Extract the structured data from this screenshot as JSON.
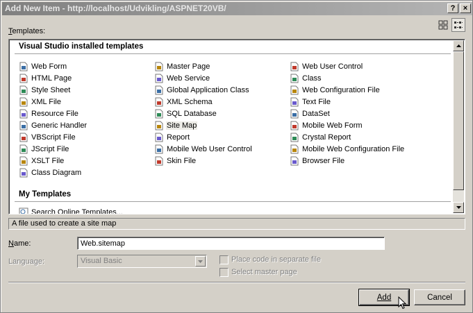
{
  "window": {
    "title": "Add New Item - http://localhost/Udvikling/ASPNET20VB/",
    "help_button": "?",
    "close_button": "×"
  },
  "templates_label": "Templates:",
  "sections": {
    "installed": "Visual Studio installed templates",
    "my": "My Templates"
  },
  "columns": [
    [
      {
        "label": "Web Form",
        "icon": "web-form-icon"
      },
      {
        "label": "HTML Page",
        "icon": "html-page-icon"
      },
      {
        "label": "Style Sheet",
        "icon": "style-sheet-icon"
      },
      {
        "label": "XML File",
        "icon": "xml-file-icon"
      },
      {
        "label": "Resource File",
        "icon": "resource-file-icon"
      },
      {
        "label": "Generic Handler",
        "icon": "generic-handler-icon"
      },
      {
        "label": "VBScript File",
        "icon": "vbscript-file-icon"
      },
      {
        "label": "JScript File",
        "icon": "jscript-file-icon"
      },
      {
        "label": "XSLT File",
        "icon": "xslt-file-icon"
      },
      {
        "label": "Class Diagram",
        "icon": "class-diagram-icon"
      }
    ],
    [
      {
        "label": "Master Page",
        "icon": "master-page-icon"
      },
      {
        "label": "Web Service",
        "icon": "web-service-icon"
      },
      {
        "label": "Global Application Class",
        "icon": "global-application-class-icon"
      },
      {
        "label": "XML Schema",
        "icon": "xml-schema-icon"
      },
      {
        "label": "SQL Database",
        "icon": "sql-database-icon"
      },
      {
        "label": "Site Map",
        "icon": "site-map-icon"
      },
      {
        "label": "Report",
        "icon": "report-icon"
      },
      {
        "label": "Mobile Web User Control",
        "icon": "mobile-web-user-control-icon"
      },
      {
        "label": "Skin File",
        "icon": "skin-file-icon"
      }
    ],
    [
      {
        "label": "Web User Control",
        "icon": "web-user-control-icon"
      },
      {
        "label": "Class",
        "icon": "class-icon"
      },
      {
        "label": "Web Configuration File",
        "icon": "web-configuration-file-icon"
      },
      {
        "label": "Text File",
        "icon": "text-file-icon"
      },
      {
        "label": "DataSet",
        "icon": "dataset-icon"
      },
      {
        "label": "Mobile Web Form",
        "icon": "mobile-web-form-icon"
      },
      {
        "label": "Crystal Report",
        "icon": "crystal-report-icon"
      },
      {
        "label": "Mobile Web Configuration File",
        "icon": "mobile-web-configuration-file-icon"
      },
      {
        "label": "Browser File",
        "icon": "browser-file-icon"
      }
    ]
  ],
  "my_templates": [
    {
      "label": "Search Online Templates...",
      "icon": "search-online-templates-icon"
    }
  ],
  "selected_item": "Site Map",
  "description": "A file used to create a site map",
  "name_label": "Name:",
  "name_value": "Web.sitemap",
  "language_label": "Language:",
  "language_value": "Visual Basic",
  "checkboxes": {
    "separate_file": "Place code in separate file",
    "master_page": "Select master page"
  },
  "buttons": {
    "add": "Add",
    "cancel": "Cancel"
  }
}
